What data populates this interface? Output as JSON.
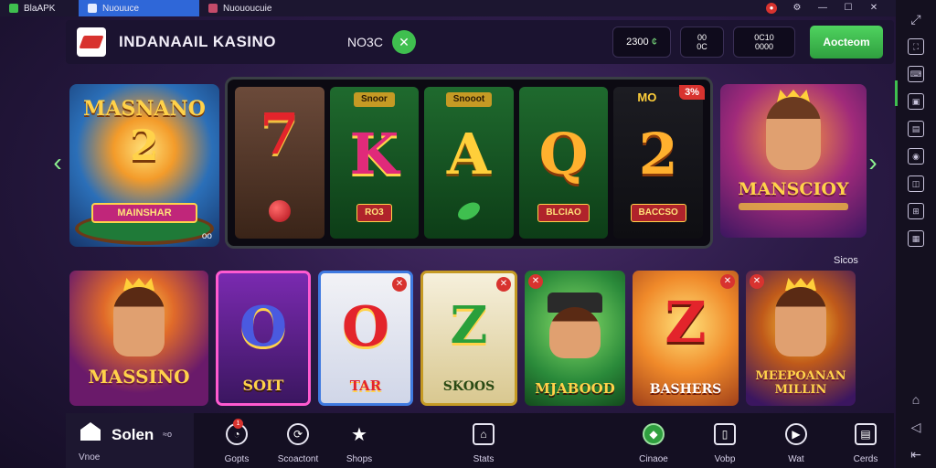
{
  "os": {
    "tabs": [
      {
        "label": "BlaAPK"
      },
      {
        "label": "Nuouuce"
      },
      {
        "label": "Nuououcuie"
      }
    ]
  },
  "header": {
    "brand": "INDANAAIL KASINO",
    "promo": "NO3C",
    "stat1": "2300",
    "stat1_suffix": "¢",
    "stat2_top": "00",
    "stat2_bottom": "0C",
    "stat3_top": "0C10",
    "stat3_bottom": "0000",
    "action_label": "Aocteom"
  },
  "featured": {
    "left_title": "MASNANO",
    "left_number": "2",
    "left_banner": "MAINSHAR",
    "left_dots": "oo",
    "right_title": "MANSCIOY"
  },
  "reels": [
    {
      "symbol": "7",
      "tag": "",
      "plate": ""
    },
    {
      "symbol": "K",
      "tag": "Snoor",
      "plate": "RO3"
    },
    {
      "symbol": "A",
      "tag": "Snooot",
      "plate": ""
    },
    {
      "symbol": "Q",
      "tag": "",
      "plate": "BLCIAO"
    },
    {
      "symbol": "2",
      "tag": "",
      "plate": "BACCSO",
      "corner": "3%",
      "corner_label": "MO"
    }
  ],
  "section_label": "Sicos",
  "games": [
    {
      "title": "MASSINO",
      "symbol": ""
    },
    {
      "title": "SOIT",
      "symbol": "O"
    },
    {
      "title": "TAR",
      "symbol": "O"
    },
    {
      "title": "SKOOS",
      "symbol": "Z"
    },
    {
      "title": "MJABOOD",
      "symbol": ""
    },
    {
      "title": "BASHERS",
      "symbol": "Z"
    },
    {
      "title": "MEEPOANAN MILLIN",
      "symbol": ""
    }
  ],
  "bottom_nav": {
    "home_title": "Solen",
    "home_small": "≈o",
    "home_label": "Vnoe",
    "items": [
      {
        "label": "Gopts",
        "icon": "gauge-icon",
        "badge": "1"
      },
      {
        "label": "Scoactont",
        "icon": "sync-icon"
      },
      {
        "label": "Shops",
        "icon": "star-icon"
      },
      {
        "label": "Stats",
        "icon": "house-icon"
      },
      {
        "label": "Cinaoe",
        "icon": "game-icon"
      },
      {
        "label": "Vobp",
        "icon": "phone-icon"
      },
      {
        "label": "Wat",
        "icon": "play-icon"
      },
      {
        "label": "Cerds",
        "icon": "cards-icon"
      }
    ]
  },
  "colors": {
    "accent_green": "#3fbf4f",
    "accent_red": "#d8332f",
    "active_tab": "#2f67d8"
  }
}
